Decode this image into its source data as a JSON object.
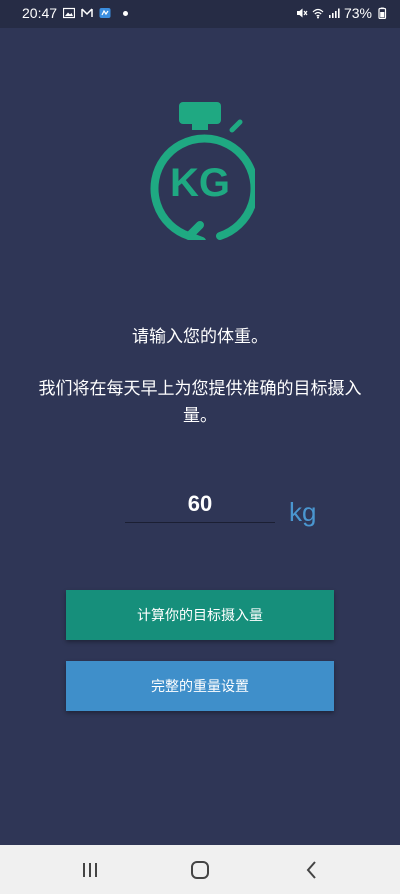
{
  "status_bar": {
    "time": "20:47",
    "battery": "73%"
  },
  "logo": {
    "text": "KG"
  },
  "prompt": {
    "line1": "请输入您的体重。",
    "line2": "我们将在每天早上为您提供准确的目标摄入量。"
  },
  "weight": {
    "value": "60",
    "unit": "kg"
  },
  "buttons": {
    "calculate": "计算你的目标摄入量",
    "settings": "完整的重量设置"
  },
  "colors": {
    "background": "#2f3656",
    "accent_green": "#168f7b",
    "accent_blue": "#3f8fca",
    "logo_green": "#1fa982"
  },
  "icons": [
    "gallery-icon",
    "mail-icon",
    "app-notification-icon",
    "mute-icon",
    "wifi-icon",
    "signal-icon",
    "battery-icon",
    "recents-icon",
    "home-icon",
    "back-icon"
  ]
}
